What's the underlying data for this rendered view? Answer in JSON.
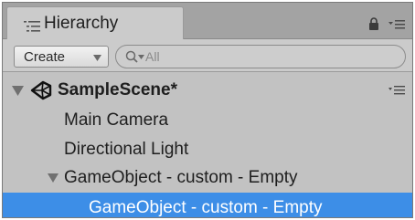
{
  "panel": {
    "title": "Hierarchy",
    "tab_icon": "list-icon",
    "lock_icon": "lock-icon",
    "menu_icon": "panel-menu-icon"
  },
  "toolbar": {
    "create_label": "Create",
    "create_caret_icon": "dropdown-caret-icon",
    "search_placeholder": "All",
    "search_icon": "search-icon"
  },
  "hierarchy": {
    "scene": {
      "name": "SampleScene*",
      "expanded": true,
      "icon": "unity-logo-icon"
    },
    "items": [
      {
        "label": "Main Camera",
        "depth": 1,
        "selected": false
      },
      {
        "label": "Directional Light",
        "depth": 1,
        "selected": false
      },
      {
        "label": "GameObject - custom - Empty",
        "depth": 1,
        "expanded": true,
        "selected": false
      },
      {
        "label": "GameObject - custom - Empty",
        "depth": 2,
        "selected": true
      }
    ]
  },
  "colors": {
    "selection": "#3d8ee7",
    "panel_bg": "#c2c2c2",
    "text": "#1e1e1e"
  }
}
